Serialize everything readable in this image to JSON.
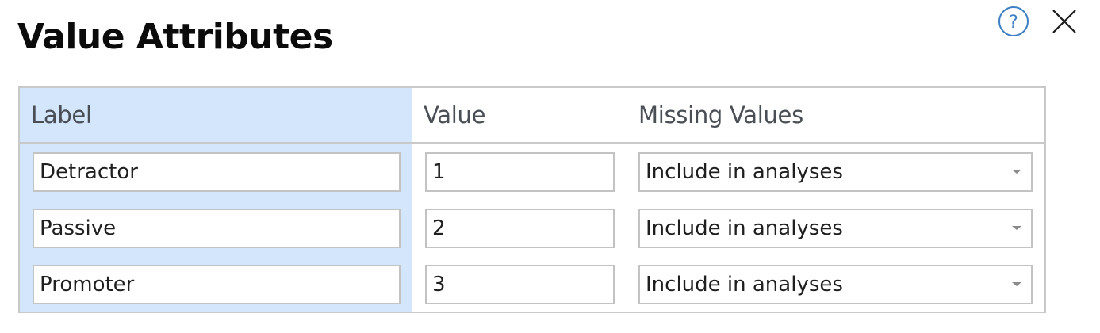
{
  "dialog": {
    "title": "Value Attributes",
    "help_icon": "help-circle-icon",
    "close_icon": "close-x-icon",
    "accent_color": "#3d7fc4",
    "label_column_highlight": "#d3e6fb"
  },
  "table": {
    "headers": {
      "label": "Label",
      "value": "Value",
      "missing": "Missing Values"
    },
    "rows": [
      {
        "label": "Detractor",
        "value": "1",
        "missing": "Include in analyses"
      },
      {
        "label": "Passive",
        "value": "2",
        "missing": "Include in analyses"
      },
      {
        "label": "Promoter",
        "value": "3",
        "missing": "Include in analyses"
      }
    ]
  }
}
